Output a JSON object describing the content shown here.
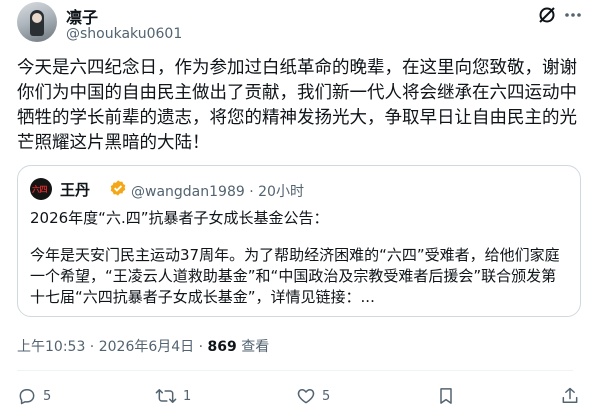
{
  "author": {
    "display_name": "凛子",
    "handle": "@shoukaku0601"
  },
  "tweet": {
    "text": "今天是六四纪念日，作为参加过白纸革命的晚辈，在这里向您致敬，谢谢你们为中国的自由民主做出了贡献，我们新一代人将会继承在六四运动中牺牲的学长前辈的遗志，将您的精神发扬光大，争取早日让自由民主的光芒照耀这片黑暗的大陆！"
  },
  "quoted": {
    "display_name": "王丹",
    "handle": "@wangdan1989",
    "separator": " · ",
    "time_ago": "20小时",
    "title": "2026年度“六.四”抗暴者子女成长基金公告：",
    "body": "今年是天安门民主运动37周年。为了帮助经济困难的“六四”受难者，给他们家庭一个希望，“王凌云人道救助基金”和“中国政治及宗教受难者后援会”联合颁发第十七届“六四抗暴者子女成长基金”，详情见链接：..."
  },
  "meta": {
    "time": "上午10:53",
    "sep1": " · ",
    "date": "2026年6月4日",
    "sep2": " · ",
    "views_count": "869",
    "views_label": " 查看"
  },
  "actions": {
    "replies": "5",
    "reposts": "1",
    "likes": "5"
  },
  "colors": {
    "text": "#0f1419",
    "muted": "#536471",
    "border": "#cfd9de",
    "verified": "#f4a819"
  }
}
